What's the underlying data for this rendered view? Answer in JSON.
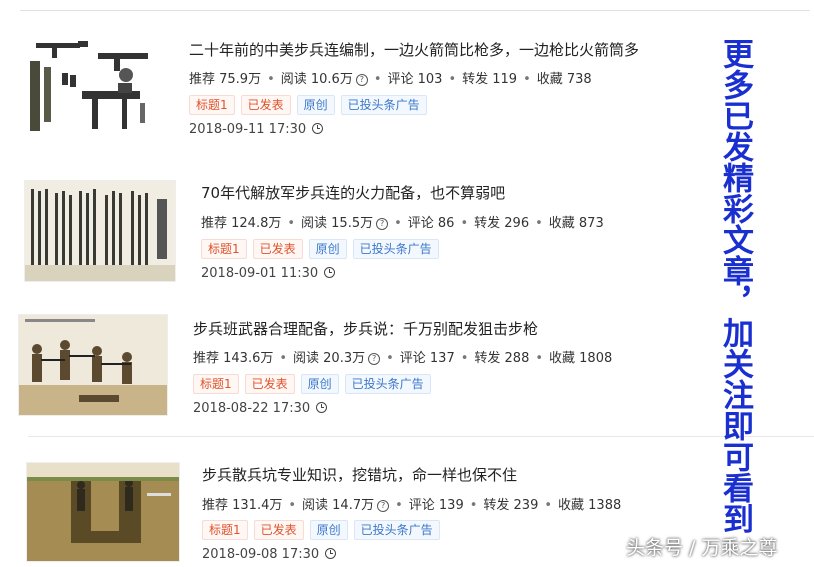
{
  "articles": [
    {
      "title": "二十年前的中美步兵连编制，一边火箭筒比枪多，一边枪比火箭筒多",
      "recommend": "推荐 75.9万",
      "read": "阅读 10.6万",
      "comment": "评论 103",
      "share": "转发 119",
      "fav": "收藏 738",
      "tags": [
        "标题1",
        "已发表",
        "原创",
        "已投头条广告"
      ],
      "date": "2018-09-11 17:30"
    },
    {
      "title": "70年代解放军步兵连的火力配备，也不算弱吧",
      "recommend": "推荐 124.8万",
      "read": "阅读 15.5万",
      "comment": "评论 86",
      "share": "转发 296",
      "fav": "收藏 873",
      "tags": [
        "标题1",
        "已发表",
        "原创",
        "已投头条广告"
      ],
      "date": "2018-09-01 11:30"
    },
    {
      "title": "步兵班武器合理配备，步兵说：千万别配发狙击步枪",
      "recommend": "推荐 143.6万",
      "read": "阅读 20.3万",
      "comment": "评论 137",
      "share": "转发 288",
      "fav": "收藏 1808",
      "tags": [
        "标题1",
        "已发表",
        "原创",
        "已投头条广告"
      ],
      "date": "2018-08-22 17:30"
    },
    {
      "title": "步兵散兵坑专业知识，挖错坑，命一样也保不住",
      "recommend": "推荐 131.4万",
      "read": "阅读 14.7万",
      "comment": "评论 139",
      "share": "转发 239",
      "fav": "收藏 1388",
      "tags": [
        "标题1",
        "已发表",
        "原创",
        "已投头条广告"
      ],
      "date": "2018-09-08 17:30"
    }
  ],
  "side_note": "更多已发精彩文章，加关注即可看到",
  "watermark": "头条号 / 万乘之尊",
  "colors": {
    "tag_red": "#e0522b",
    "tag_blue": "#3b78c9",
    "side_note": "#1a2fd0"
  },
  "icons": {
    "read_help": "question-circle-icon",
    "date": "clock-icon"
  }
}
